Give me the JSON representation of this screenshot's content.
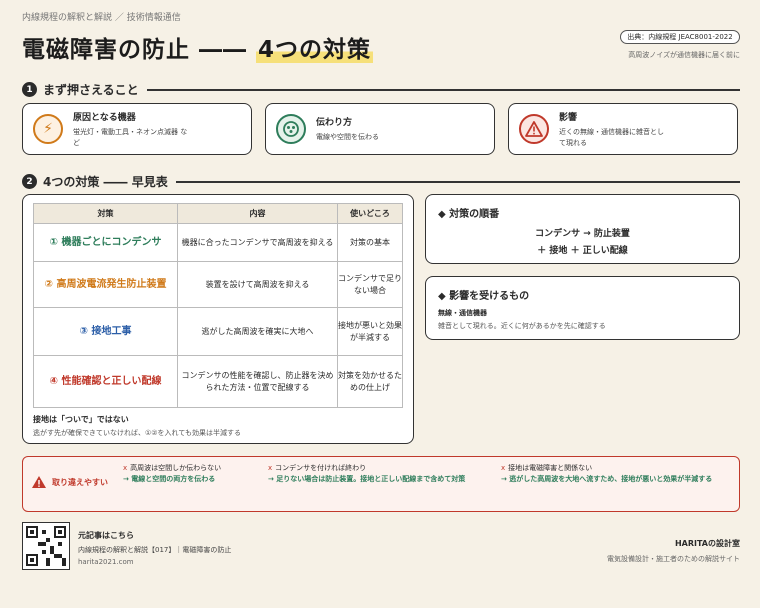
{
  "breadcrumb": "内線規程の解釈と解説 ／ 技術情報通信",
  "title_main": "電磁障害の防止 ―― ",
  "title_highlight": "4つの対策",
  "source": "出典：内線規程 JEAC8001-2022",
  "subnote": "高周波ノイズが通信機器に届く前に",
  "section1": {
    "num": "1",
    "title": "まず押さえること"
  },
  "cards": [
    {
      "title": "原因となる機器",
      "body": "蛍光灯・電動工具・ネオン点滅器 など",
      "icon": "lightning-icon"
    },
    {
      "title": "伝わり方",
      "body": "電線や空間を伝わる",
      "icon": "signal-icon"
    },
    {
      "title": "影響",
      "body": "近くの無線・通信機器に雑音として現れる",
      "icon": "warning-icon"
    }
  ],
  "section2": {
    "num": "2",
    "title": "4つの対策 ―― 早見表"
  },
  "table": {
    "headers": [
      "対策",
      "内容",
      "使いどころ"
    ],
    "rows": [
      {
        "measure": "① 機器ごとにコンデンサ",
        "content": "機器に合ったコンデンサで高周波を抑える",
        "use": "対策の基本"
      },
      {
        "measure": "② 高周波電流発生防止装置",
        "content": "装置を設けて高周波を抑える",
        "use": "コンデンサで足りない場合"
      },
      {
        "measure": "③ 接地工事",
        "content": "逃がした高周波を確実に大地へ",
        "use": "接地が悪いと効果が半減する"
      },
      {
        "measure": "④ 性能確認と正しい配線",
        "content": "コンデンサの性能を確認し、防止器を決められた方法・位置で配線する",
        "use": "対策を効かせるための仕上げ"
      }
    ],
    "note_title": "接地は「ついで」ではない",
    "note_body": "逃がす先が確保できていなければ、①②を入れても効果は半減する"
  },
  "order": {
    "title": "対策の順番",
    "line1": "コンデンサ → 防止装置",
    "line2": "＋ 接地 ＋ 正しい配線"
  },
  "affected": {
    "title": "影響を受けるもの",
    "sub": "無線・通信機器",
    "body": "雑音として現れる。近くに何があるかを先に確認する"
  },
  "warning": {
    "label": "取り違えやすい",
    "items": [
      {
        "wrong": "高周波は空間しか伝わらない",
        "right": "→ 電線と空間の両方を伝わる"
      },
      {
        "wrong": "コンデンサを付ければ終わり",
        "right": "→ 足りない場合は防止装置。接地と正しい配線まで含めて対策"
      },
      {
        "wrong": "接地は電磁障害と関係ない",
        "right": "→ 逃がした高周波を大地へ流すため、接地が悪いと効果が半減する"
      }
    ]
  },
  "footer": {
    "label": "元記事はこちら",
    "article": "内線規程の解釈と解説【017】｜電磁障害の防止",
    "url": "harita2021.com",
    "brand": "HARITAの設計室",
    "tagline": "電気設備設計・施工者のための解説サイト"
  },
  "colors": {
    "accent_green": "#2e7d5b",
    "accent_orange": "#d07a1a",
    "accent_blue": "#2d5fa8",
    "accent_red": "#c0392b"
  }
}
